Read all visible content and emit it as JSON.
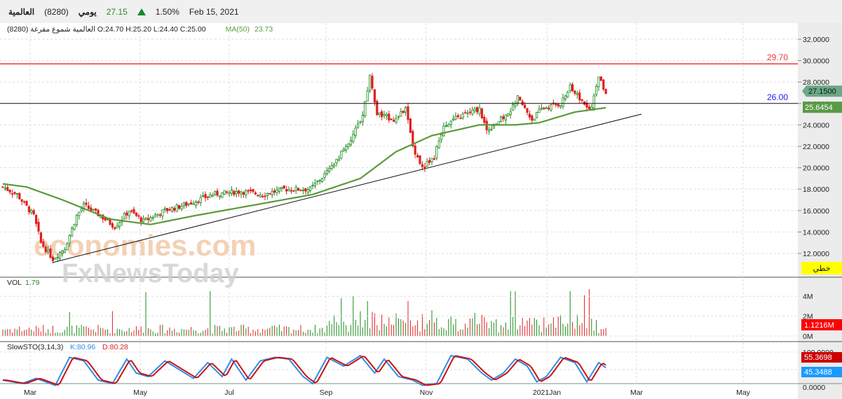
{
  "header": {
    "name": "العالمية",
    "code": "(8280)",
    "period": "يومي",
    "price": "27.15",
    "change_pct": "1.50%",
    "date": "Feb 15, 2021"
  },
  "info": {
    "text": "العالمية شموع مفرغة (8280) O:24.70  H:25.20  L:24.40  C:25.00",
    "ma_label": "MA(50)",
    "ma_value": "23.73"
  },
  "price_axis": {
    "ticks": [
      "32.0000",
      "30.0000",
      "28.0000",
      "26.0000",
      "24.0000",
      "22.0000",
      "20.0000",
      "18.0000",
      "16.0000",
      "14.0000",
      "12.0000"
    ],
    "tick_values": [
      32,
      30,
      28,
      26,
      24,
      22,
      20,
      18,
      16,
      14,
      12
    ],
    "last_price": "27.1500",
    "ma_price": "25.6454",
    "mode_button": "خطي"
  },
  "lines": {
    "resistance": "29.70",
    "resistance_value": 29.7,
    "support": "26.00",
    "support_value": 26.0
  },
  "volume": {
    "label": "VOL",
    "value": "1.79",
    "ticks": [
      "4M",
      "2M",
      "0M"
    ],
    "last": "1.1216M"
  },
  "stoch": {
    "label": "SlowSTO(3,14,3)",
    "k": "K:80.96",
    "d": "D:80.28",
    "ticks": [
      "100.0000",
      "0.0000"
    ],
    "k_last": "55.3698",
    "d_last": "45.3488"
  },
  "x_axis": {
    "labels": [
      "Mar",
      "May",
      "Jul",
      "Sep",
      "Nov",
      "2021Jan",
      "Mar",
      "May"
    ]
  },
  "watermark": {
    "line1": "economies.com",
    "line2": "FxNewsToday"
  },
  "colors": {
    "up": "#1a8a1a",
    "down": "#e02020",
    "ma": "#5a9a3a",
    "resistance": "#e83a3a",
    "k": "#2e8ee8",
    "d": "#cc1010"
  },
  "chart_data": {
    "type": "candlestick",
    "price_keypoints": [
      [
        0,
        18.2
      ],
      [
        6,
        17.5
      ],
      [
        13,
        15.5
      ],
      [
        16,
        13
      ],
      [
        21,
        11.5
      ],
      [
        26,
        12.5
      ],
      [
        31,
        15.5
      ],
      [
        34,
        16.5
      ],
      [
        41,
        15.5
      ],
      [
        47,
        14.5
      ],
      [
        53,
        16
      ],
      [
        59,
        15
      ],
      [
        68,
        16
      ],
      [
        76,
        16.5
      ],
      [
        88,
        17.5
      ],
      [
        100,
        17.8
      ],
      [
        109,
        17.5
      ],
      [
        118,
        18
      ],
      [
        129,
        18
      ],
      [
        138,
        20
      ],
      [
        147,
        23
      ],
      [
        151,
        25
      ],
      [
        154,
        28.5
      ],
      [
        157,
        25
      ],
      [
        165,
        24.5
      ],
      [
        169,
        25.5
      ],
      [
        172,
        22
      ],
      [
        176,
        20
      ],
      [
        181,
        21
      ],
      [
        185,
        24
      ],
      [
        194,
        25
      ],
      [
        200,
        25.5
      ],
      [
        203,
        23.5
      ],
      [
        212,
        25
      ],
      [
        216,
        26.5
      ],
      [
        222,
        24.5
      ],
      [
        226,
        25.5
      ],
      [
        234,
        26
      ],
      [
        238,
        27.5
      ],
      [
        244,
        26
      ],
      [
        247,
        25.5
      ],
      [
        250,
        28.5
      ],
      [
        253,
        27
      ]
    ],
    "ma_keypoints": [
      [
        0,
        18.5
      ],
      [
        10,
        18.2
      ],
      [
        25,
        17
      ],
      [
        45,
        15.2
      ],
      [
        62,
        14.7
      ],
      [
        80,
        15.5
      ],
      [
        100,
        16.3
      ],
      [
        130,
        17.5
      ],
      [
        150,
        19
      ],
      [
        165,
        21.5
      ],
      [
        180,
        23
      ],
      [
        200,
        24
      ],
      [
        215,
        24
      ],
      [
        225,
        24.2
      ],
      [
        240,
        25.2
      ],
      [
        253,
        25.6
      ]
    ],
    "stoch_keypoints": [
      [
        0,
        20
      ],
      [
        8,
        10
      ],
      [
        14,
        25
      ],
      [
        22,
        5
      ],
      [
        28,
        85
      ],
      [
        34,
        75
      ],
      [
        40,
        20
      ],
      [
        46,
        10
      ],
      [
        52,
        80
      ],
      [
        56,
        40
      ],
      [
        61,
        30
      ],
      [
        68,
        75
      ],
      [
        74,
        50
      ],
      [
        80,
        25
      ],
      [
        86,
        70
      ],
      [
        92,
        30
      ],
      [
        96,
        80
      ],
      [
        102,
        20
      ],
      [
        108,
        75
      ],
      [
        114,
        85
      ],
      [
        120,
        80
      ],
      [
        126,
        30
      ],
      [
        130,
        10
      ],
      [
        136,
        85
      ],
      [
        143,
        60
      ],
      [
        150,
        90
      ],
      [
        156,
        40
      ],
      [
        160,
        80
      ],
      [
        166,
        30
      ],
      [
        172,
        20
      ],
      [
        176,
        5
      ],
      [
        182,
        10
      ],
      [
        188,
        90
      ],
      [
        195,
        80
      ],
      [
        201,
        40
      ],
      [
        205,
        20
      ],
      [
        210,
        40
      ],
      [
        215,
        80
      ],
      [
        220,
        60
      ],
      [
        224,
        15
      ],
      [
        228,
        30
      ],
      [
        234,
        85
      ],
      [
        240,
        70
      ],
      [
        245,
        15
      ],
      [
        250,
        70
      ],
      [
        253,
        55
      ]
    ],
    "volume_spikes": [
      [
        28,
        2.4
      ],
      [
        46,
        2.5
      ],
      [
        60,
        4.4
      ],
      [
        87,
        4.5
      ],
      [
        142,
        3.8
      ],
      [
        147,
        4.0
      ],
      [
        150,
        2.5
      ],
      [
        153,
        3.5
      ],
      [
        170,
        3.5
      ],
      [
        180,
        2.6
      ],
      [
        213,
        4.5
      ],
      [
        215,
        4.5
      ],
      [
        238,
        4.5
      ],
      [
        244,
        4.1
      ],
      [
        246,
        4.7
      ]
    ],
    "x_range_days": [
      0,
      330
    ],
    "ylim": [
      11,
      33
    ]
  }
}
